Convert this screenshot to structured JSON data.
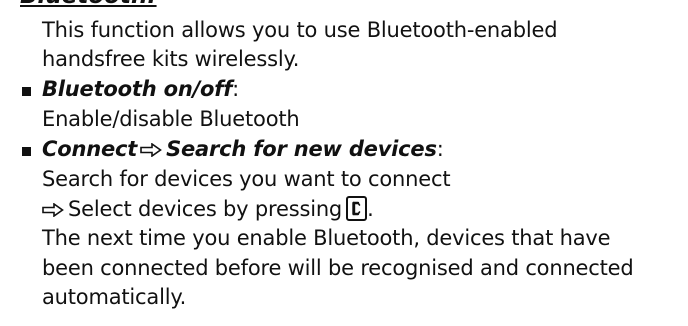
{
  "heading": "Bluetooth:",
  "intro_line1": "This function allows you to use Bluetooth-enabled",
  "intro_line2": "handsfree kits wirelessly.",
  "item1": {
    "title": "Bluetooth on/off",
    "colon": ":",
    "desc": "Enable/disable Bluetooth"
  },
  "item2": {
    "title_part1": "Connect",
    "title_part2": "Search for new devices",
    "colon": ":",
    "desc_line1": "Search for devices you want to connect",
    "desc_line2": "Select devices by pressing",
    "desc_line2_end": ".",
    "desc_line3": "The next time you enable Bluetooth, devices that have",
    "desc_line4": "been connected before will be recognised and connected",
    "desc_line5": "automatically."
  },
  "icons": {
    "arrow": "outlined-right-arrow-icon",
    "key": "phone-key-icon"
  }
}
